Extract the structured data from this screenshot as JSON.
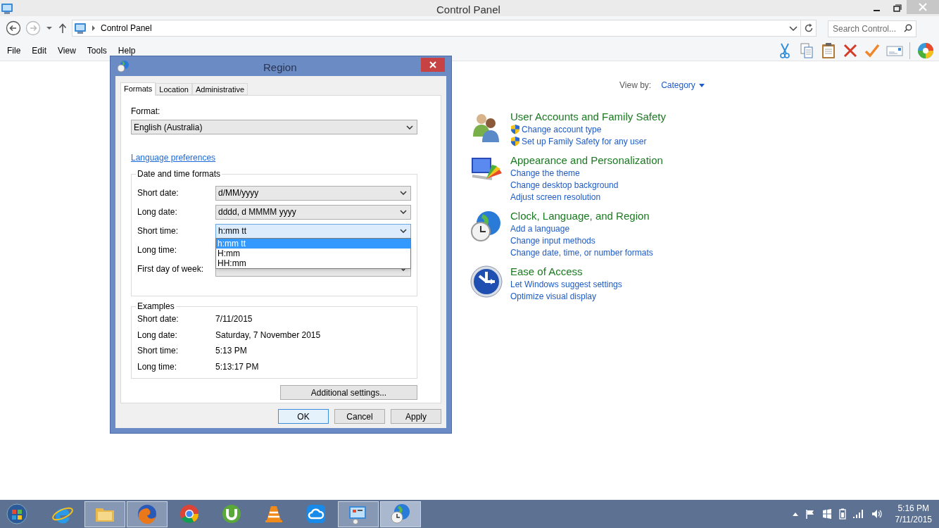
{
  "window": {
    "title": "Control Panel"
  },
  "nav": {
    "address": "Control Panel",
    "search_placeholder": "Search Control..."
  },
  "menu": [
    "File",
    "Edit",
    "View",
    "Tools",
    "Help"
  ],
  "view_by": {
    "label": "View by:",
    "value": "Category"
  },
  "categories": [
    {
      "title": "User Accounts and Family Safety",
      "links": [
        {
          "text": "Change account type",
          "shield": true
        },
        {
          "text": "Set up Family Safety for any user",
          "shield": true
        }
      ]
    },
    {
      "title": "Appearance and Personalization",
      "links": [
        {
          "text": "Change the theme",
          "shield": false
        },
        {
          "text": "Change desktop background",
          "shield": false
        },
        {
          "text": "Adjust screen resolution",
          "shield": false
        }
      ]
    },
    {
      "title": "Clock, Language, and Region",
      "links": [
        {
          "text": "Add a language",
          "shield": false
        },
        {
          "text": "Change input methods",
          "shield": false
        },
        {
          "text": "Change date, time, or number formats",
          "shield": false
        }
      ]
    },
    {
      "title": "Ease of Access",
      "links": [
        {
          "text": "Let Windows suggest settings",
          "shield": false
        },
        {
          "text": "Optimize visual display",
          "shield": false
        }
      ]
    }
  ],
  "dialog": {
    "title": "Region",
    "tabs": [
      {
        "label": "Formats",
        "selected": true
      },
      {
        "label": "Location",
        "selected": false
      },
      {
        "label": "Administrative",
        "selected": false
      }
    ],
    "format_label": "Format:",
    "format_value": "English (Australia)",
    "language_link": "Language preferences",
    "group_title": "Date and time formats",
    "fields": [
      {
        "label": "Short date:",
        "value": "d/MM/yyyy",
        "focused": false
      },
      {
        "label": "Long date:",
        "value": "dddd, d MMMM yyyy",
        "focused": false
      },
      {
        "label": "Short time:",
        "value": "h:mm tt",
        "focused": true,
        "options": [
          {
            "text": "h:mm tt",
            "selected": true
          },
          {
            "text": "H:mm",
            "selected": false
          },
          {
            "text": "HH:mm",
            "selected": false
          }
        ]
      },
      {
        "label": "Long time:"
      },
      {
        "label": "First day of week:",
        "focused": false
      }
    ],
    "examples_title": "Examples",
    "examples": [
      {
        "label": "Short date:",
        "value": "7/11/2015"
      },
      {
        "label": "Long date:",
        "value": "Saturday, 7 November 2015"
      },
      {
        "label": "Short time:",
        "value": "5:13 PM"
      },
      {
        "label": "Long time:",
        "value": "5:13:17 PM"
      }
    ],
    "additional_button": "Additional settings...",
    "buttons": [
      {
        "label": "OK",
        "default": true
      },
      {
        "label": "Cancel",
        "default": false
      },
      {
        "label": "Apply",
        "default": false
      }
    ]
  },
  "taskbar": {
    "apps": [
      {
        "running": false,
        "selected": false
      },
      {
        "running": true,
        "selected": false
      },
      {
        "running": true,
        "selected": false
      },
      {
        "running": false,
        "selected": false
      },
      {
        "running": false,
        "selected": false
      },
      {
        "running": false,
        "selected": false
      },
      {
        "running": false,
        "selected": false
      },
      {
        "running": true,
        "selected": false
      },
      {
        "running": true,
        "selected": true
      }
    ],
    "time": "5:16 PM",
    "date": "7/11/2015"
  }
}
